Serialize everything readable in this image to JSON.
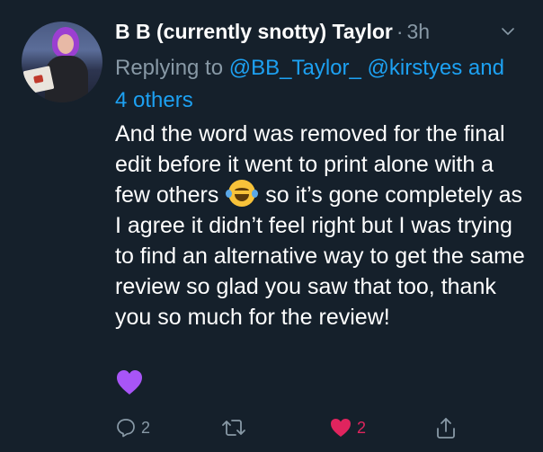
{
  "tweet": {
    "author_name": "B B (currently snotty) Taylor",
    "separator": "·",
    "time": "3h",
    "reply_prefix": "Replying to",
    "reply_mention_1": "@BB_Taylor_",
    "reply_mention_2": "@kirstyes",
    "reply_others": "and 4 others",
    "body_part1": "And the word was removed for the final edit before it went to print alone with a few others",
    "body_part2": "so it’s gone completely as I agree it didn’t feel right but I was trying to find an alternative way to get the same review so glad you saw that too, thank you so much for the review!",
    "emoji_inline": "face-with-tears-of-joy",
    "emoji_end": "purple-heart"
  },
  "actions": {
    "reply_count": "2",
    "retweet_count": "",
    "like_count": "2",
    "like_color": "#e0245e"
  },
  "colors": {
    "background": "#15202b",
    "text": "#ffffff",
    "muted": "#8899a6",
    "link": "#1da1f2"
  }
}
